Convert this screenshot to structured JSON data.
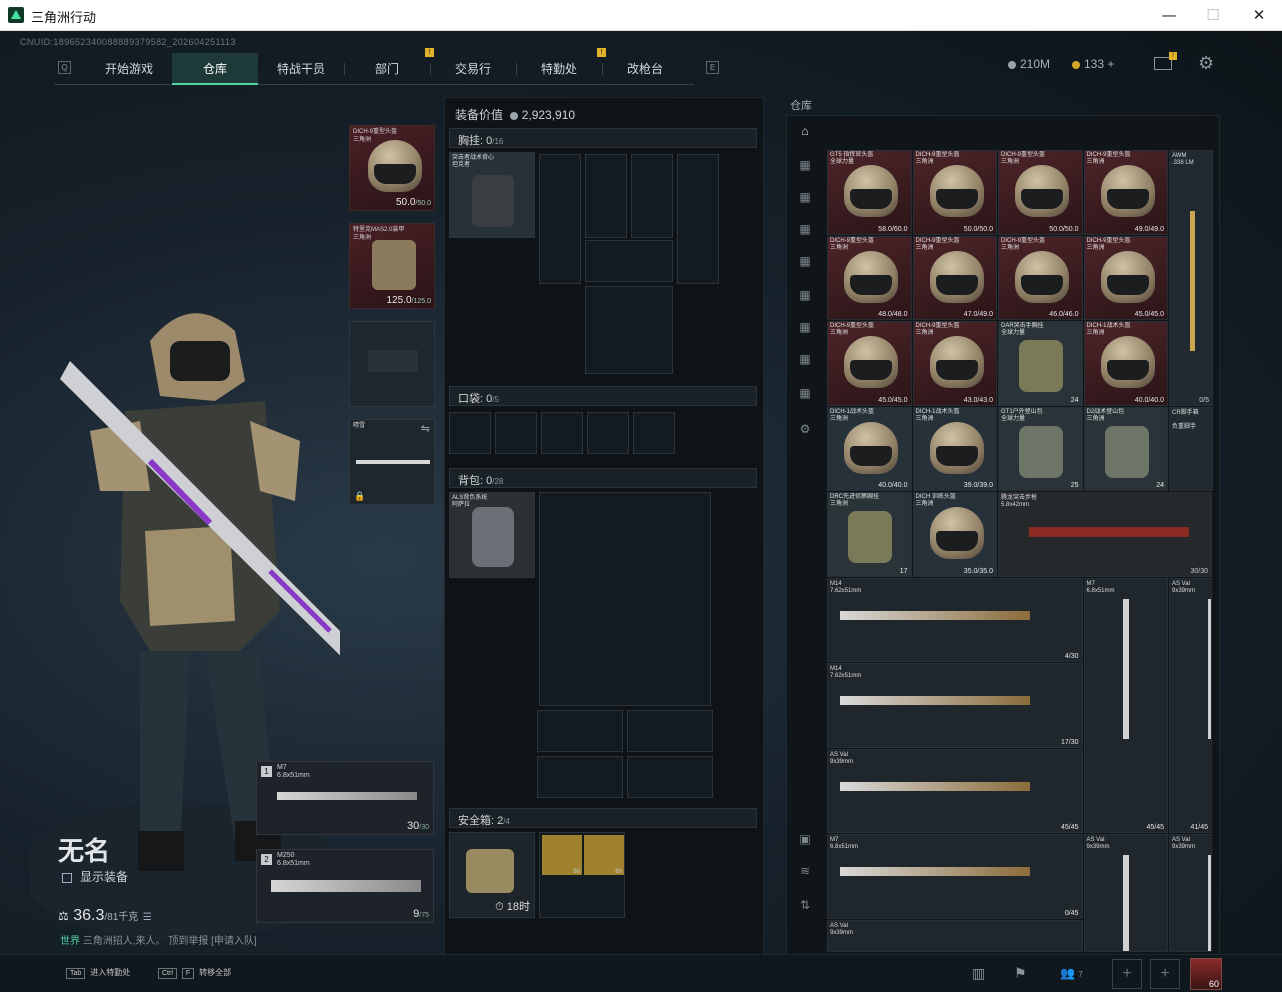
{
  "window": {
    "title": "三角洲行动",
    "min": "—",
    "max": "☐",
    "close": "✕"
  },
  "uid": "CNUID:189652340088889379582_202604251113",
  "nav": {
    "tabs": [
      {
        "label": "开始游戏"
      },
      {
        "label": "仓库"
      },
      {
        "label": "特战干员"
      },
      {
        "label": "部门"
      },
      {
        "label": "交易行"
      },
      {
        "label": "特勤处"
      },
      {
        "label": "改枪台"
      }
    ],
    "left_key": "Q",
    "right_key": "E",
    "active_tab": "仓库",
    "badge": "!"
  },
  "currency": {
    "money": "210M",
    "coupons": "133",
    "plus": "+"
  },
  "loadout": {
    "helmet": {
      "name": "DICH-9重型头盔",
      "sub": "三角洲",
      "value": "50.0",
      "max": "/50.0"
    },
    "armor": {
      "name": "特里克MAS2.0装甲",
      "sub": "三角洲",
      "value": "125.0",
      "max": "/125.0"
    },
    "melee": {
      "name": "晴雪"
    },
    "weapon1": {
      "num": "1",
      "name": "M7",
      "caliber": "6.8x51mm",
      "ammo": "30",
      "max": "/30"
    },
    "weapon2": {
      "num": "2",
      "name": "M250",
      "caliber": "6.8x51mm",
      "ammo": "9",
      "max": "/75"
    }
  },
  "player": {
    "name": "无名",
    "show_equipment": "显示装备",
    "weight": "36.3",
    "weight_max": "/81千克"
  },
  "chat": {
    "channel": "世界",
    "text": "三角洲招人,来人。 顶到举报",
    "link": "[申请入队]"
  },
  "equipment": {
    "label": "装备价值",
    "value": "2,923,910",
    "chest": {
      "label": "胸挂:",
      "used": "0",
      "cap": "/16",
      "item": "突击者战术背心",
      "item_sub": "坦克者"
    },
    "pocket": {
      "label": "口袋:",
      "used": "0",
      "cap": "/5"
    },
    "backpack": {
      "label": "背包:",
      "used": "0",
      "cap": "/28",
      "item": "ALS背负系统",
      "item_sub": "阿萨拉"
    },
    "safebox": {
      "label": "安全箱:",
      "used": "2",
      "cap": "/4",
      "time": "18时",
      "ammo_count": "60"
    }
  },
  "warehouse": {
    "label": "仓库",
    "items": [
      {
        "name": "GT5 指挥官头盔",
        "sub": "全球力量",
        "v": "58.0/60.0",
        "t": "helmet"
      },
      {
        "name": "DICH-9重型头盔",
        "sub": "三角洲",
        "v": "50.0/50.0",
        "t": "helmet"
      },
      {
        "name": "DICH-9重型头盔",
        "sub": "三角洲",
        "v": "50.0/50.0",
        "t": "helmet"
      },
      {
        "name": "DICH-9重型头盔",
        "sub": "三角洲",
        "v": "49.0/49.0",
        "t": "helmet"
      },
      {
        "name": "DICH-9重型头盔",
        "sub": "三角洲",
        "v": "48.0/48.0",
        "t": "helmet"
      },
      {
        "name": "DICH-9重型头盔",
        "sub": "三角洲",
        "v": "47.0/49.0",
        "t": "helmet"
      },
      {
        "name": "DICH-9重型头盔",
        "sub": "三角洲",
        "v": "46.0/46.0",
        "t": "helmet"
      },
      {
        "name": "DICH-9重型头盔",
        "sub": "三角洲",
        "v": "45.0/45.0",
        "t": "helmet"
      },
      {
        "name": "DICH-9重型头盔",
        "sub": "三角洲",
        "v": "45.0/45.0",
        "t": "helmet"
      },
      {
        "name": "DICH-9重型头盔",
        "sub": "三角洲",
        "v": "43.0/43.0",
        "t": "helmet"
      },
      {
        "name": "DAR突击手胸挂",
        "sub": "全球力量",
        "v": "24",
        "t": "bag"
      },
      {
        "name": "DICH-1战术头盔",
        "sub": "三角洲",
        "v": "40.0/40.0",
        "t": "helmet"
      },
      {
        "name": "DICH-1战术头盔",
        "sub": "三角洲",
        "v": "40.0/40.0",
        "t": "helmet"
      },
      {
        "name": "DICH-1战术头盔",
        "sub": "三角洲",
        "v": "39.0/39.0",
        "t": "helmet"
      },
      {
        "name": "GT1户外登山包",
        "sub": "全球力量",
        "v": "25",
        "t": "pack"
      },
      {
        "name": "D2战术登山包",
        "sub": "三角洲",
        "v": "24",
        "t": "pack"
      },
      {
        "name": "DRC先进侦察胸挂",
        "sub": "三角洲",
        "v": "17",
        "t": "bag"
      },
      {
        "name": "DICH 训练头盔",
        "sub": "三角洲",
        "v": "35.0/35.0",
        "t": "helmet"
      }
    ],
    "awm": {
      "name": "AWM",
      ".cal": ".338 LM",
      "cal": ".338 LM",
      "ammo": "0/5"
    },
    "cr": {
      "name": "CR脚手箱",
      "sub": "负重脚手"
    },
    "rifle_red": {
      "name": "腾龙突击步枪",
      "cal": "5.8x42mm",
      "ammo": "30/30"
    },
    "guns": [
      {
        "name": "M14",
        "cal": "7.62x51mm",
        "ammo": "4/30"
      },
      {
        "name": "M7",
        "cal": "6.8x51mm",
        "ammo": "45/45"
      },
      {
        "name": "AS Val",
        "cal": "9x39mm",
        "ammo": "41/45"
      },
      {
        "name": "M14",
        "cal": "7.62x51mm",
        "ammo": "17/30"
      },
      {
        "name": "AS Val",
        "cal": "9x39mm",
        "ammo": "45/45"
      },
      {
        "name": "AS Val",
        "cal": "9x39mm",
        "ammo": ""
      },
      {
        "name": "AS Val",
        "cal": "9x39mm",
        "ammo": ""
      },
      {
        "name": "M7",
        "cal": "6.8x51mm",
        "ammo": "0/45"
      },
      {
        "name": "AS Val",
        "cal": "9x39mm",
        "ammo": ""
      }
    ]
  },
  "bottom": {
    "k1": "Tab",
    "l1": "进入特勤处",
    "k2": "Ctrl",
    "k2b": "F",
    "l2": "转移全部",
    "friends": "7",
    "level": "60"
  }
}
